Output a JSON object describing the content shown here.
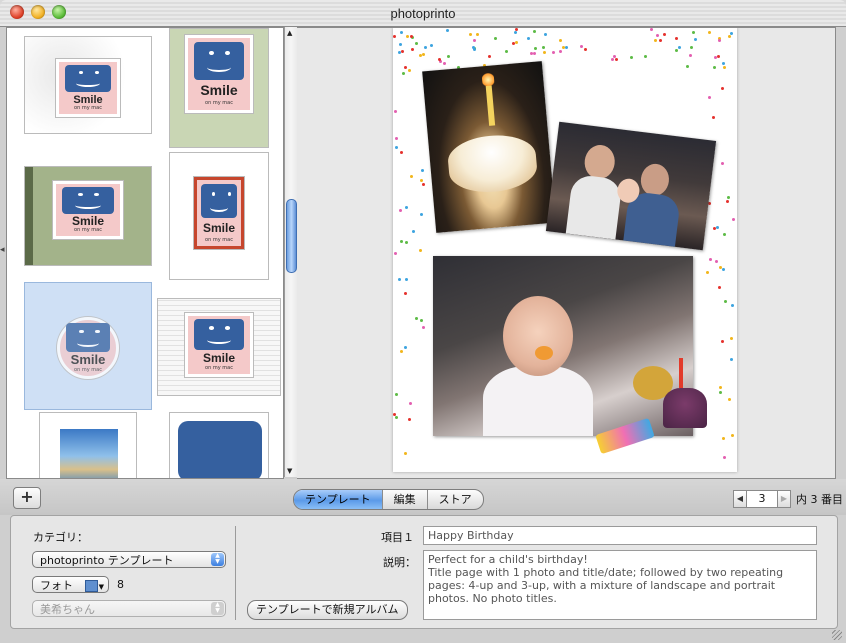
{
  "window": {
    "title": "photoprinto"
  },
  "templates": [
    {
      "text": "Smile",
      "sub": "on my mac"
    },
    {
      "text": "Smile",
      "sub": "on my mac"
    },
    {
      "text": "Smile",
      "sub": "on my mac"
    },
    {
      "text": "Smile",
      "sub": "on my mac"
    },
    {
      "text": "Smile",
      "sub": "on my mac"
    },
    {
      "text": "Smile",
      "sub": "on my mac"
    }
  ],
  "toolbar": {
    "add_label": "+",
    "tabs": [
      {
        "label": "テンプレート",
        "active": true
      },
      {
        "label": "編集",
        "active": false
      },
      {
        "label": "ストア",
        "active": false
      }
    ],
    "page_number": "3",
    "page_suffix": "内 3 番目"
  },
  "panel": {
    "category_label": "カテゴリ：",
    "category_value": "photoprinto テンプレート",
    "photo_value": "フォト",
    "photo_count": "8",
    "person_value": "美希ちゃん",
    "new_album_button": "テンプレートで新規アルバム",
    "item_label": "項目１",
    "item_value": "Happy Birthday",
    "desc_label": "説明：",
    "desc_value": "Perfect for a child's birthday!\nTitle page with 1 photo and title/date; followed by two repeating pages: 4-up and 3-up, with a mixture of landscape and portrait photos. No photo titles."
  },
  "colors": {
    "accent": "#5b9ae8",
    "selection": "#cfe0f5"
  }
}
